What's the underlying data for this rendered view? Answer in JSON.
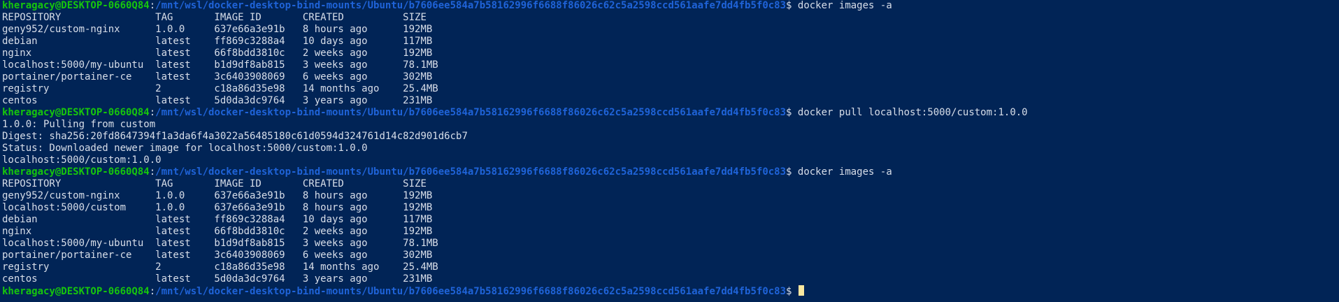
{
  "theme": {
    "background": "#012456",
    "foreground": "#d8dee9",
    "prompt_user_color": "#16c60c",
    "prompt_path_color": "#1f63d8",
    "cursor_color": "#f9e79f"
  },
  "prompt": {
    "user": "kheragacy@DESKTOP-0660Q84",
    "path": "/mnt/wsl/docker-desktop-bind-mounts/Ubuntu/b7606ee584a7b58162996f6688f86026c62c5a2598ccd561aafe7dd4fb5f0c83"
  },
  "lines": [
    {
      "type": "prompt",
      "command": "docker images -a"
    },
    {
      "type": "output",
      "text": "REPOSITORY                TAG       IMAGE ID       CREATED          SIZE"
    },
    {
      "type": "output",
      "text": "geny952/custom-nginx      1.0.0     637e66a3e91b   8 hours ago      192MB"
    },
    {
      "type": "output",
      "text": "debian                    latest    ff869c3288a4   10 days ago      117MB"
    },
    {
      "type": "output",
      "text": "nginx                     latest    66f8bdd3810c   2 weeks ago      192MB"
    },
    {
      "type": "output",
      "text": "localhost:5000/my-ubuntu  latest    b1d9df8ab815   3 weeks ago      78.1MB"
    },
    {
      "type": "output",
      "text": "portainer/portainer-ce    latest    3c6403908069   6 weeks ago      302MB"
    },
    {
      "type": "output",
      "text": "registry                  2         c18a86d35e98   14 months ago    25.4MB"
    },
    {
      "type": "output",
      "text": "centos                    latest    5d0da3dc9764   3 years ago      231MB"
    },
    {
      "type": "prompt",
      "command": "docker pull localhost:5000/custom:1.0.0"
    },
    {
      "type": "output",
      "text": "1.0.0: Pulling from custom"
    },
    {
      "type": "output",
      "text": "Digest: sha256:20fd8647394f1a3da6f4a3022a56485180c61d0594d324761d14c82d901d6cb7"
    },
    {
      "type": "output",
      "text": "Status: Downloaded newer image for localhost:5000/custom:1.0.0"
    },
    {
      "type": "output",
      "text": "localhost:5000/custom:1.0.0"
    },
    {
      "type": "prompt",
      "command": "docker images -a"
    },
    {
      "type": "output",
      "text": "REPOSITORY                TAG       IMAGE ID       CREATED          SIZE"
    },
    {
      "type": "output",
      "text": "geny952/custom-nginx      1.0.0     637e66a3e91b   8 hours ago      192MB"
    },
    {
      "type": "output",
      "text": "localhost:5000/custom     1.0.0     637e66a3e91b   8 hours ago      192MB"
    },
    {
      "type": "output",
      "text": "debian                    latest    ff869c3288a4   10 days ago      117MB"
    },
    {
      "type": "output",
      "text": "nginx                     latest    66f8bdd3810c   2 weeks ago      192MB"
    },
    {
      "type": "output",
      "text": "localhost:5000/my-ubuntu  latest    b1d9df8ab815   3 weeks ago      78.1MB"
    },
    {
      "type": "output",
      "text": "portainer/portainer-ce    latest    3c6403908069   6 weeks ago      302MB"
    },
    {
      "type": "output",
      "text": "registry                  2         c18a86d35e98   14 months ago    25.4MB"
    },
    {
      "type": "output",
      "text": "centos                    latest    5d0da3dc9764   3 years ago      231MB"
    },
    {
      "type": "prompt",
      "command": ""
    }
  ]
}
